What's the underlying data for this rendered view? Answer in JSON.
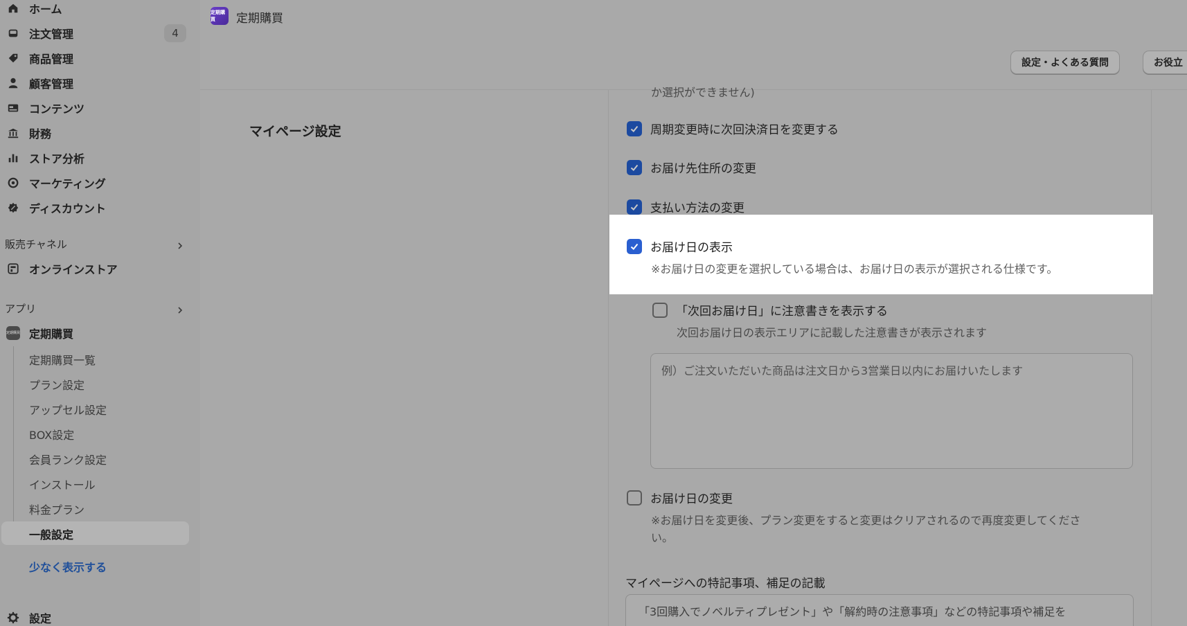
{
  "sidebar": {
    "nav": [
      {
        "label": "ホーム",
        "icon": "home-icon"
      },
      {
        "label": "注文管理",
        "icon": "inbox-icon",
        "badge": "4"
      },
      {
        "label": "商品管理",
        "icon": "tag-icon"
      },
      {
        "label": "顧客管理",
        "icon": "person-icon"
      },
      {
        "label": "コンテンツ",
        "icon": "content-icon"
      },
      {
        "label": "財務",
        "icon": "bank-icon"
      },
      {
        "label": "ストア分析",
        "icon": "bar-chart-icon"
      },
      {
        "label": "マーケティング",
        "icon": "target-icon"
      },
      {
        "label": "ディスカウント",
        "icon": "discount-icon"
      }
    ],
    "sales_channel_header": "販売チャネル",
    "online_store": "オンラインストア",
    "apps_header": "アプリ",
    "app_name": "定期購買",
    "app_sub": [
      "定期購買一覧",
      "プラン設定",
      "アップセル設定",
      "BOX設定",
      "会員ランク設定",
      "インストール",
      "料金プラン",
      "一般設定"
    ],
    "show_less": "少なく表示する",
    "settings": "設定"
  },
  "topbar": {
    "logo_text": "定期購買",
    "title": "定期購買",
    "btn_faq": "設定・よくある質問",
    "btn_help": "お役立"
  },
  "main": {
    "section_title": "マイページ設定",
    "clipped": "か選択ができません)",
    "options": {
      "cycle_change": "周期変更時に次回決済日を変更する",
      "address_change": "お届け先住所の変更",
      "payment_change": "支払い方法の変更",
      "delivery_display": "お届け日の表示",
      "delivery_display_help": "※お届け日の変更を選択している場合は、お届け日の表示が選択される仕様です。",
      "next_note": "「次回お届け日」に注意書きを表示する",
      "next_note_help": "次回お届け日の表示エリアに記載した注意書きが表示されます",
      "next_note_placeholder": "例）ご注文いただいた商品は注文日から3営業日以内にお届けいたします",
      "delivery_change": "お届け日の変更",
      "delivery_change_help_1": "※お届け日を変更後、プラン変更をすると変更はクリアされるので再度変更してくださ",
      "delivery_change_help_2": "い。"
    },
    "notes_label": "マイページへの特記事項、補足の記載",
    "notes_placeholder": "「3回購入でノベルティプレゼント」や「解約時の注意事項」などの特記事項や補足を"
  }
}
